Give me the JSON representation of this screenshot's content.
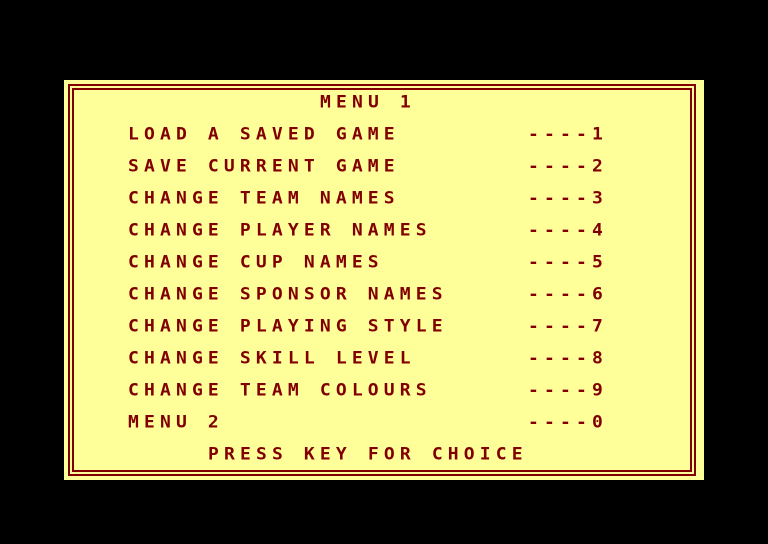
{
  "menu": {
    "title": "MENU 1",
    "items": [
      {
        "label": "LOAD A SAVED GAME",
        "key": "----1"
      },
      {
        "label": "SAVE CURRENT GAME",
        "key": "----2"
      },
      {
        "label": "CHANGE TEAM NAMES",
        "key": "----3"
      },
      {
        "label": "CHANGE PLAYER NAMES",
        "key": "----4"
      },
      {
        "label": "CHANGE CUP NAMES",
        "key": "----5"
      },
      {
        "label": "CHANGE SPONSOR NAMES",
        "key": "----6"
      },
      {
        "label": "CHANGE PLAYING STYLE",
        "key": "----7"
      },
      {
        "label": "CHANGE SKILL LEVEL",
        "key": "----8"
      },
      {
        "label": "CHANGE TEAM COLOURS",
        "key": "----9"
      },
      {
        "label": "MENU 2",
        "key": "----0"
      }
    ],
    "prompt": "PRESS KEY FOR CHOICE"
  },
  "colors": {
    "background": "#000000",
    "panel": "#FFFF99",
    "ink": "#800000"
  }
}
